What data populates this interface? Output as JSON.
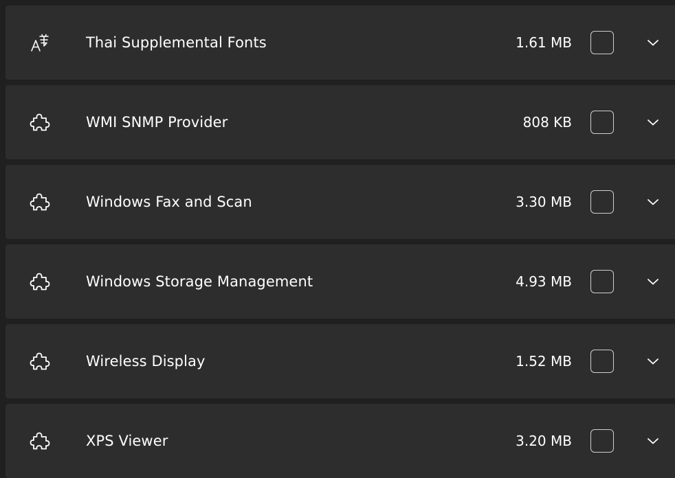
{
  "features": [
    {
      "icon": "font-language-icon",
      "name": "Thai Supplemental Fonts",
      "size": "1.61 MB",
      "checked": false
    },
    {
      "icon": "puzzle-piece-icon",
      "name": "WMI SNMP Provider",
      "size": "808 KB",
      "checked": false
    },
    {
      "icon": "puzzle-piece-icon",
      "name": "Windows Fax and Scan",
      "size": "3.30 MB",
      "checked": false
    },
    {
      "icon": "puzzle-piece-icon",
      "name": "Windows Storage Management",
      "size": "4.93 MB",
      "checked": false
    },
    {
      "icon": "puzzle-piece-icon",
      "name": "Wireless Display",
      "size": "1.52 MB",
      "checked": false
    },
    {
      "icon": "puzzle-piece-icon",
      "name": "XPS Viewer",
      "size": "3.20 MB",
      "checked": false
    }
  ],
  "colors": {
    "background": "#202020",
    "card": "#2d2d2d",
    "text": "#ffffff",
    "checkbox_border": "#d0d0d0"
  }
}
